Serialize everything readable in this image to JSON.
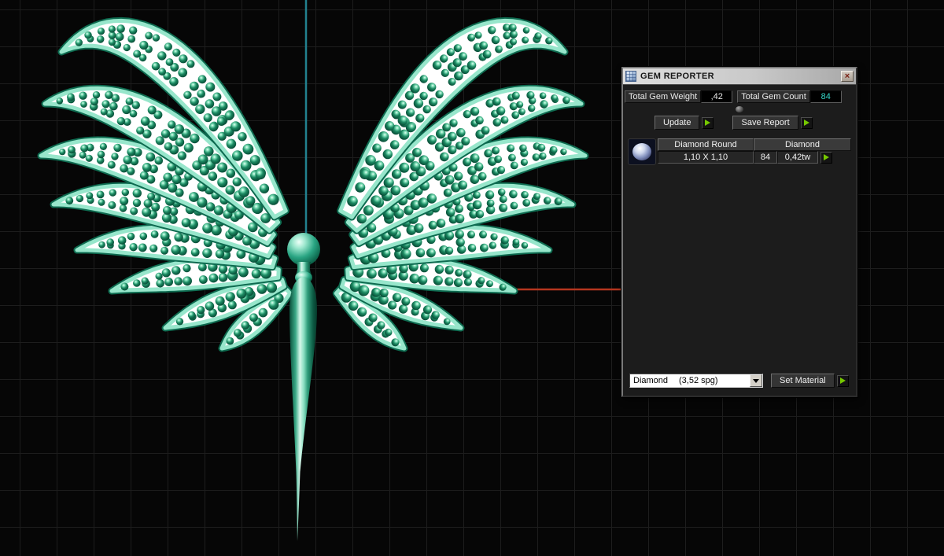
{
  "panel": {
    "title": "GEM REPORTER",
    "close_label": "×",
    "stats": {
      "weight_label": "Total Gem Weight",
      "weight_value": ",42",
      "count_label": "Total Gem Count",
      "count_value": "84"
    },
    "buttons": {
      "update": "Update",
      "save_report": "Save Report",
      "set_material": "Set Material"
    },
    "table": {
      "gem_type": "Diamond Round",
      "material": "Diamond",
      "size": "1,10 X 1,10",
      "count": "84",
      "weight": "0,42tw"
    },
    "material_dropdown": {
      "name": "Diamond",
      "spg": "(3,52 spg)"
    }
  },
  "colors": {
    "gem_green": "#1d8a63",
    "metal_teal": "#2aa583",
    "pave_white": "#ffffff",
    "wing_outline_mint": "#97e6cb",
    "accent_arrow_green": "#76c800",
    "count_value_cyan": "#35d8c8",
    "axis_line_red": "#b5361f",
    "axis_line_teal": "#22818f",
    "grid_line": "#1d1d1d",
    "viewport_background": "#060606"
  }
}
